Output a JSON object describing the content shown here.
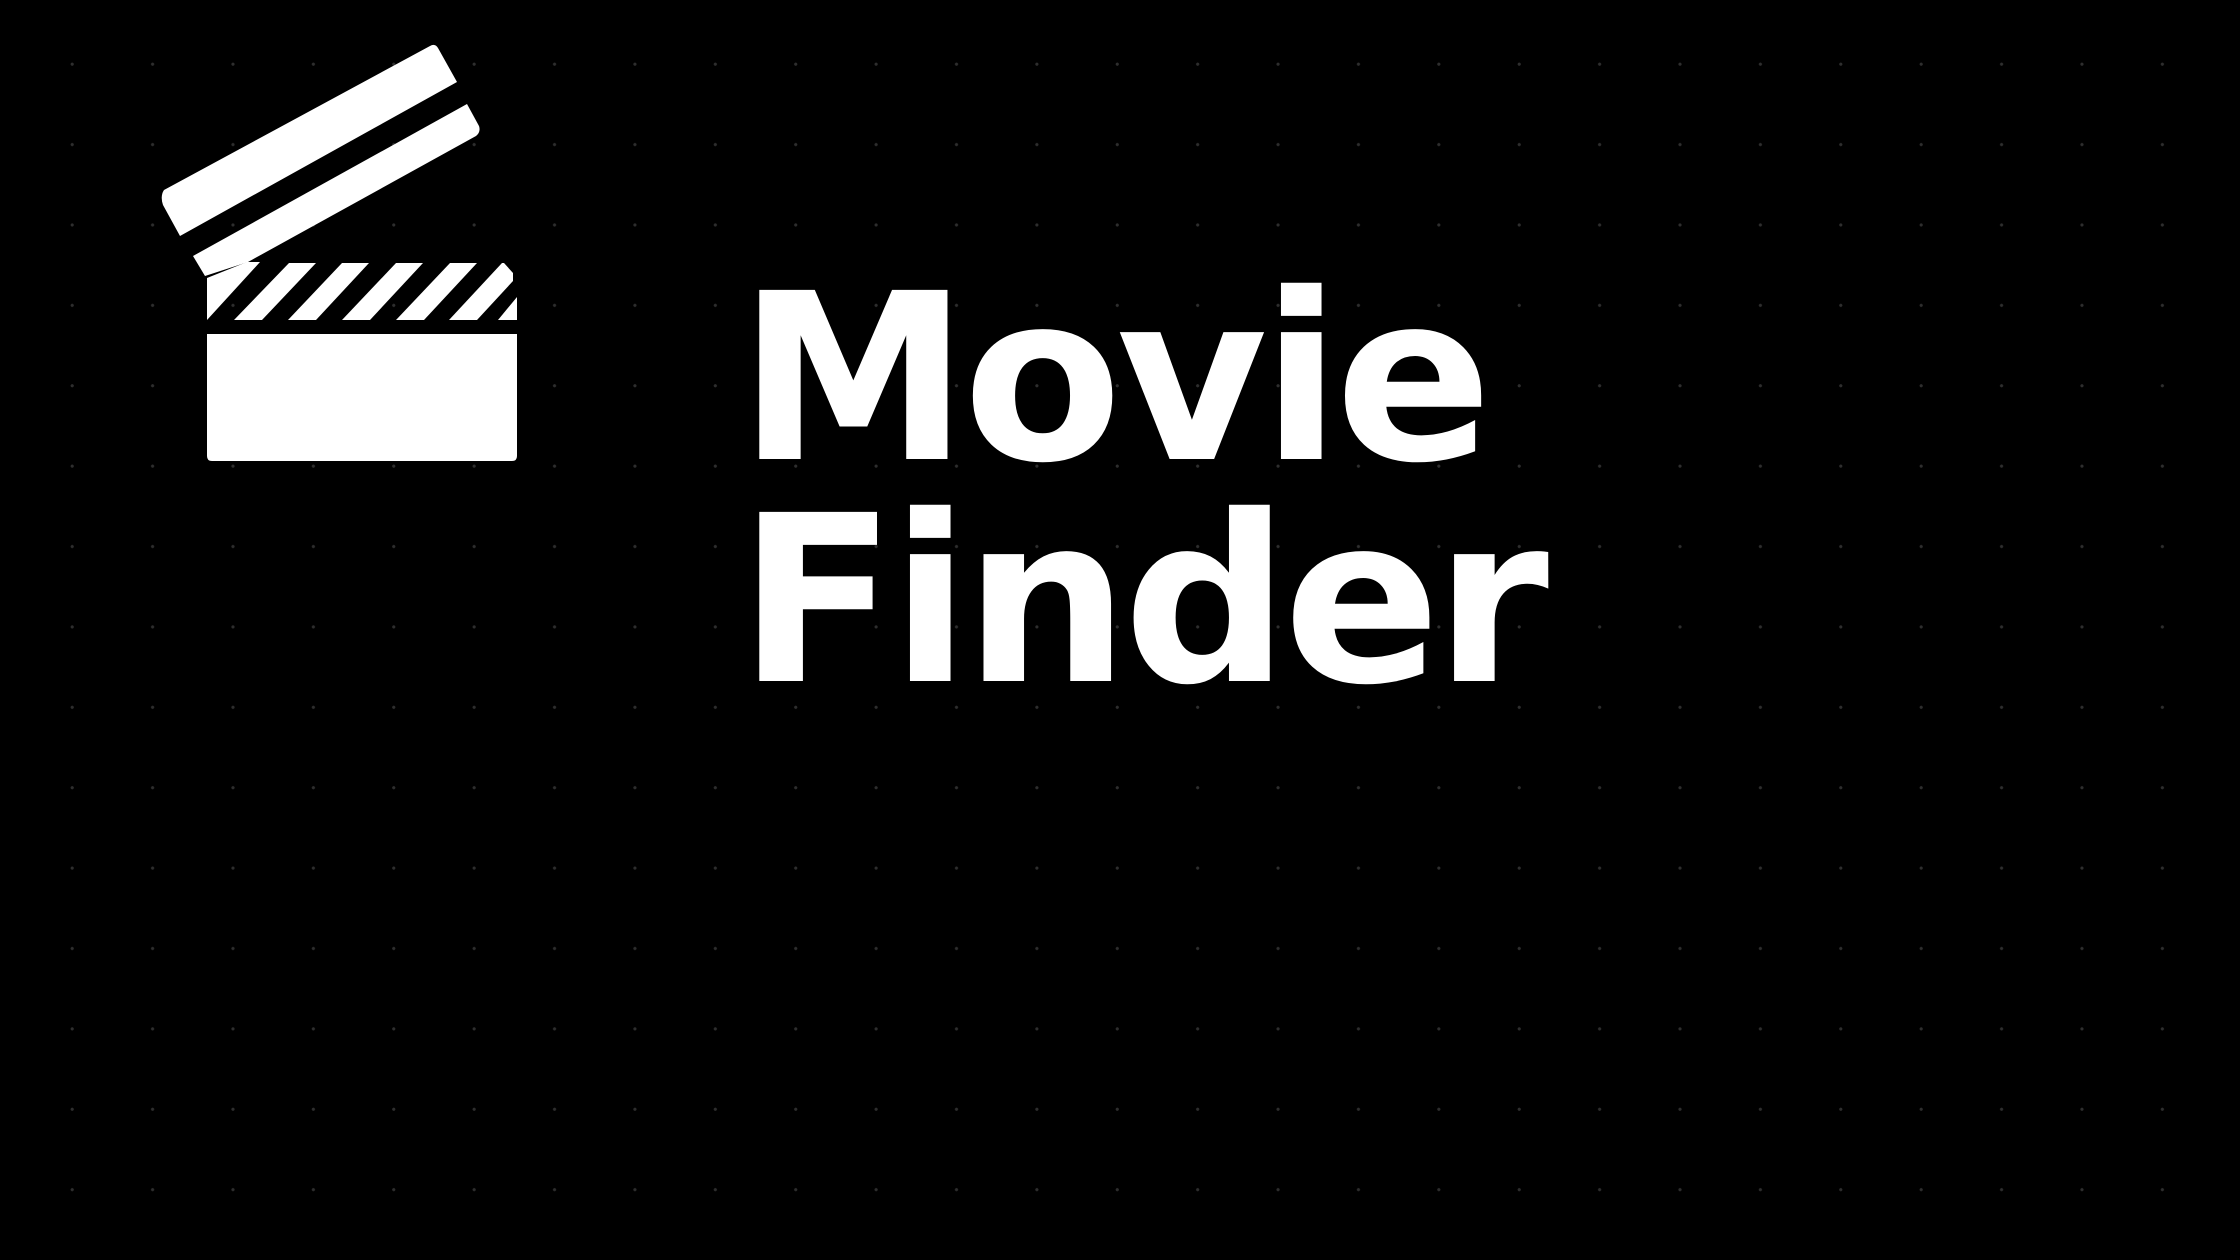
{
  "app": {
    "title_line_1": "Movie",
    "title_line_2": "Finder"
  },
  "logo": {
    "icon": "clapperboard-icon"
  },
  "colors": {
    "background": "#000000",
    "foreground": "#ffffff",
    "grid_dot": "#2e2e2e"
  }
}
